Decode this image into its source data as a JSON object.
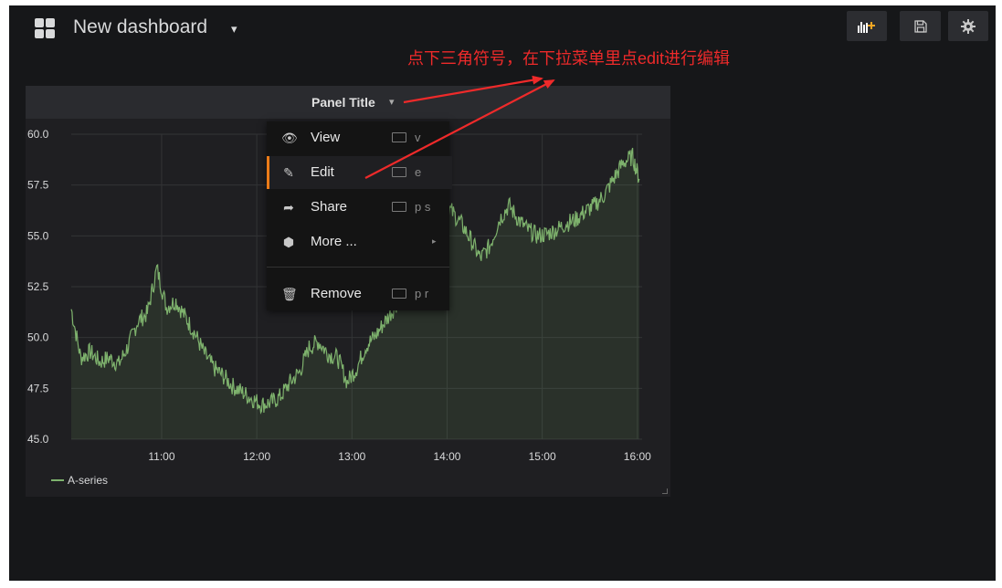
{
  "dashboard": {
    "title": "New dashboard",
    "title_caret": "▾",
    "icon": "dashboard-grid-icon"
  },
  "toolbar": {
    "buttons": [
      {
        "name": "add-panel-button",
        "icon": "bar-chart-plus-icon"
      },
      {
        "name": "save-button",
        "icon": "floppy-disk-icon"
      },
      {
        "name": "settings-button",
        "icon": "gear-icon"
      }
    ]
  },
  "annotation": {
    "text": "点下三角符号，在下拉菜单里点edit进行编辑",
    "color": "#ee2a2a"
  },
  "panel": {
    "title": "Panel Title",
    "title_caret": "▾",
    "menu": {
      "items": [
        {
          "label": "View",
          "icon": "eye-icon",
          "shortcut": "v",
          "active": false
        },
        {
          "label": "Edit",
          "icon": "edit-icon",
          "shortcut": "e",
          "active": true
        },
        {
          "label": "Share",
          "icon": "share-icon",
          "shortcut": "p s",
          "active": false
        },
        {
          "label": "More ...",
          "icon": "cube-icon",
          "shortcut": "",
          "submenu_arrow": "▸",
          "active": false
        },
        {
          "label": "Remove",
          "icon": "trash-icon",
          "shortcut": "p r",
          "active": false
        }
      ],
      "active_accent": "#eb7b18"
    }
  },
  "chart_data": {
    "type": "area",
    "title": "Panel Title",
    "xlabel": "",
    "ylabel": "",
    "x_tick_labels": [
      "11:00",
      "12:00",
      "13:00",
      "14:00",
      "15:00",
      "16:00"
    ],
    "y_tick_labels": [
      "45.0",
      "47.5",
      "50.0",
      "52.5",
      "55.0",
      "57.5",
      "60.0"
    ],
    "ylim": [
      45.0,
      60.0
    ],
    "xlim_hours": [
      10.05,
      16.05
    ],
    "grid": true,
    "legend_position": "bottom-left",
    "series": [
      {
        "name": "A-series",
        "color": "#7eb26d",
        "x_hours": [
          10.05,
          10.15,
          10.25,
          10.35,
          10.45,
          10.55,
          10.65,
          10.75,
          10.85,
          10.95,
          11.05,
          11.15,
          11.25,
          11.35,
          11.45,
          11.55,
          11.65,
          11.75,
          11.85,
          11.95,
          12.05,
          12.15,
          12.25,
          12.35,
          12.45,
          12.55,
          12.65,
          12.75,
          12.85,
          12.95,
          13.05,
          13.15,
          13.25,
          13.35,
          13.45,
          13.55,
          13.65,
          13.75,
          13.85,
          13.95,
          14.05,
          14.15,
          14.25,
          14.35,
          14.45,
          14.55,
          14.65,
          14.75,
          14.85,
          14.95,
          15.05,
          15.15,
          15.25,
          15.35,
          15.45,
          15.55,
          15.65,
          15.75,
          15.85,
          15.95,
          16.02
        ],
        "values": [
          51.4,
          49.0,
          49.3,
          48.8,
          49.0,
          48.7,
          49.6,
          50.8,
          51.2,
          53.4,
          51.5,
          51.8,
          51.0,
          50.2,
          49.2,
          48.5,
          48.1,
          47.6,
          47.3,
          47.0,
          46.7,
          46.8,
          47.1,
          47.8,
          48.3,
          49.5,
          49.8,
          49.2,
          49.0,
          47.8,
          48.5,
          49.6,
          50.1,
          50.8,
          51.5,
          52.4,
          54.0,
          55.8,
          56.3,
          56.6,
          56.2,
          55.6,
          54.8,
          53.9,
          54.5,
          55.8,
          56.5,
          55.8,
          55.3,
          55.0,
          55.1,
          55.3,
          55.6,
          55.8,
          56.2,
          56.5,
          57.0,
          57.8,
          58.6,
          58.9,
          57.8
        ]
      }
    ]
  }
}
